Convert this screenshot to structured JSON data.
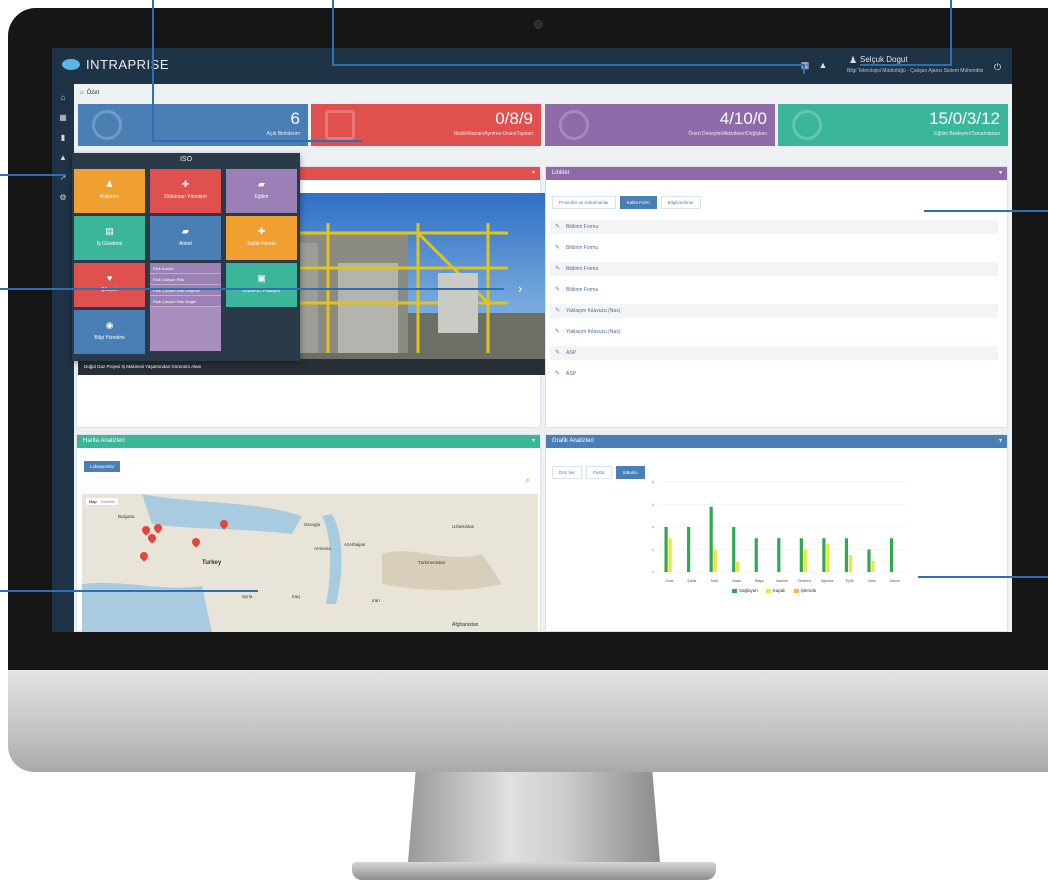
{
  "app": {
    "logo": "INTRAPRISE"
  },
  "user": {
    "name": "Selçuk Dogut",
    "role": "Bilgi Teknolojisi Müdürlüğü · Çalışan Ajansı Sistem Mühendisi"
  },
  "breadcrumb": {
    "home": "Özet"
  },
  "stats": [
    {
      "value": "6",
      "label": "Açık Birimlerim",
      "color": "#4a7fb5"
    },
    {
      "value": "0/8/9",
      "label": "Riskli/Atanan/Ayrılma Oranı/Yapılan",
      "color": "#e0504f"
    },
    {
      "value": "4/10/0",
      "label": "Öneri Deneyim/Aktiviteler/Değişken",
      "color": "#8e6aa8"
    },
    {
      "value": "15/0/3/12",
      "label": "Eğitim Bekleyen/Tamamlanan",
      "color": "#3bb69a"
    }
  ],
  "iso_menu": {
    "title": "ISO",
    "tiles": [
      {
        "label": "Kullanıcı",
        "icon": "♟",
        "color": "#f0a030"
      },
      {
        "label": "Döküman Yönetimi",
        "icon": "✚",
        "color": "#e0504f"
      },
      {
        "label": "Eğitim",
        "icon": "▰",
        "color": "#9b7fb7"
      },
      {
        "label": "İş Gündemi",
        "icon": "▤",
        "color": "#3bb69a"
      },
      {
        "label": "Anket",
        "icon": "▰",
        "color": "#4a7fb5"
      },
      {
        "label": "Kalite Formu",
        "icon": "✚",
        "color": "#f0a030"
      },
      {
        "label": "Şikayet",
        "icon": "♥",
        "color": "#e0504f"
      },
      {
        "label": "Düzeltici Faaliyet",
        "icon": "▣",
        "color": "#3bb69a"
      },
      {
        "label": "Bilgi Yönetimi",
        "icon": "◉",
        "color": "#4a7fb5"
      }
    ],
    "list_title": "Risk Analizi",
    "list": [
      "Risk Çalışan Risk",
      "Risk Çalışan Risk Dağılımı",
      "Risk Çalışan Risk Değer"
    ]
  },
  "photo_panel": {
    "caption": "Doğal Gaz Projesi İş Makinesi Yaşamından Görünüm Alanı"
  },
  "links_panel": {
    "title": "Linkler",
    "tabs": [
      "Prosedür ve Dokümanlar",
      "Kalite Form",
      "Bilgilendirme"
    ],
    "active_tab": 1,
    "items": [
      "Bildirim Formu",
      "Bildirim Formu",
      "Bildirim Formu",
      "Bildirim Formu",
      "Yaklaşım Kılavuzu (Nas)",
      "Yaklaşım Kılavuzu (Nas)",
      "ASP",
      "ASP"
    ]
  },
  "map_panel": {
    "title": "Harita Analizleri",
    "button": "Lokasyonlar",
    "map_types": [
      "Map",
      "Satellite"
    ],
    "labels": [
      "Bulgaria",
      "Georgia",
      "Turkey",
      "Turkmenistan",
      "Afghanistan",
      "Uzbekistan",
      "Syria",
      "Iraq",
      "Iran",
      "Azerbaijan",
      "Armenia"
    ]
  },
  "chart_panel": {
    "title": "Grafik Analizleri",
    "tabs": [
      "Düz Ver",
      "Pasta",
      "Sütunlu"
    ],
    "active_tab": 2
  },
  "chart_data": {
    "type": "bar",
    "categories": [
      "Ocak",
      "Şubat",
      "Mart",
      "Nisan",
      "Mayıs",
      "Haziran",
      "Temmuz",
      "Ağustos",
      "Eylül",
      "Ekim",
      "Kasım"
    ],
    "series": [
      {
        "name": "Sağlayan",
        "color": "#2fa84f",
        "values": [
          4,
          4,
          5.8,
          4,
          3,
          3,
          3,
          3,
          3,
          2,
          3
        ]
      },
      {
        "name": "Kapalı",
        "color": "#f2e23a",
        "values": [
          3,
          0,
          2,
          0.9,
          0,
          0,
          2,
          2.5,
          1.5,
          1,
          0
        ]
      },
      {
        "name": "İşlemde",
        "color": "#f0b84a",
        "values": [
          0,
          0,
          0,
          0,
          0,
          0,
          0,
          0,
          0,
          0,
          0
        ]
      }
    ],
    "ylim": [
      0,
      8
    ]
  },
  "colors": {
    "topbar": "#1f3347",
    "blue": "#4a7fb5",
    "red": "#e0504f",
    "purple": "#8e6aa8",
    "teal": "#3bb69a"
  }
}
